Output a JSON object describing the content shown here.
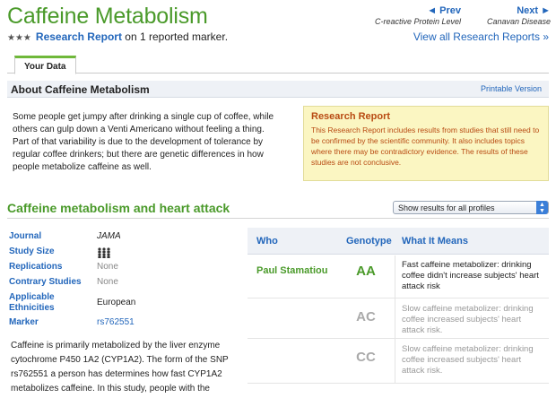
{
  "page": {
    "title": "Caffeine Metabolism"
  },
  "nav": {
    "prev_label": "◄ Prev",
    "prev_sub": "C-reactive Protein Level",
    "next_label": "Next ►",
    "next_sub": "Canavan Disease"
  },
  "report": {
    "stars": "★★★",
    "link_label": "Research Report",
    "suffix": "on 1 reported marker.",
    "view_all": "View all Research Reports »"
  },
  "tabs": [
    {
      "label": "Your Data"
    }
  ],
  "about": {
    "title": "About Caffeine Metabolism",
    "printable": "Printable Version",
    "text": "Some people get jumpy after drinking a single cup of coffee, while others can gulp down a Venti Americano without feeling a thing. Part of that variability is due to the development of tolerance by regular coffee drinkers; but there are genetic differences in how people metabolize caffeine as well."
  },
  "notice": {
    "title": "Research Report",
    "body": "This Research Report includes results from studies that still need to be confirmed by the scientific community. It also includes topics where there may be contradictory evidence. The results of these studies are not conclusive."
  },
  "section": {
    "title": "Caffeine metabolism and heart attack",
    "select_value": "Show results for all profiles"
  },
  "meta": {
    "journal_label": "Journal",
    "journal_value": "JAMA",
    "study_size_label": "Study Size",
    "replications_label": "Replications",
    "replications_value": "None",
    "contrary_label": "Contrary Studies",
    "contrary_value": "None",
    "ethnicities_label_1": "Applicable",
    "ethnicities_label_2": "Ethnicities",
    "ethnicities_value": "European",
    "marker_label": "Marker",
    "marker_value": "rs762551"
  },
  "body_text": "Caffeine is primarily metabolized by the liver enzyme cytochrome P450 1A2 (CYP1A2). The form of the SNP rs762551 a person has determines how fast CYP1A2 metabolizes caffeine. In this study, people with the",
  "table": {
    "headers": {
      "who": "Who",
      "genotype": "Genotype",
      "meaning": "What It Means"
    },
    "rows": [
      {
        "who": "Paul Stamatiou",
        "genotype": "AA",
        "meaning": "Fast caffeine metabolizer: drinking coffee didn't increase subjects' heart attack risk"
      },
      {
        "who": "",
        "genotype": "AC",
        "meaning": "Slow caffeine metabolizer: drinking coffee increased subjects' heart attack risk."
      },
      {
        "who": "",
        "genotype": "CC",
        "meaning": "Slow caffeine metabolizer: drinking coffee increased subjects' heart attack risk."
      }
    ]
  },
  "colors": {
    "accent_green": "#4a9a2a",
    "link_blue": "#2266bb",
    "notice_text": "#b84a12",
    "notice_bg": "#fbf6c2"
  },
  "icons": {
    "study_size": "people-group-icon",
    "select_arrow": "select-arrows-icon"
  }
}
